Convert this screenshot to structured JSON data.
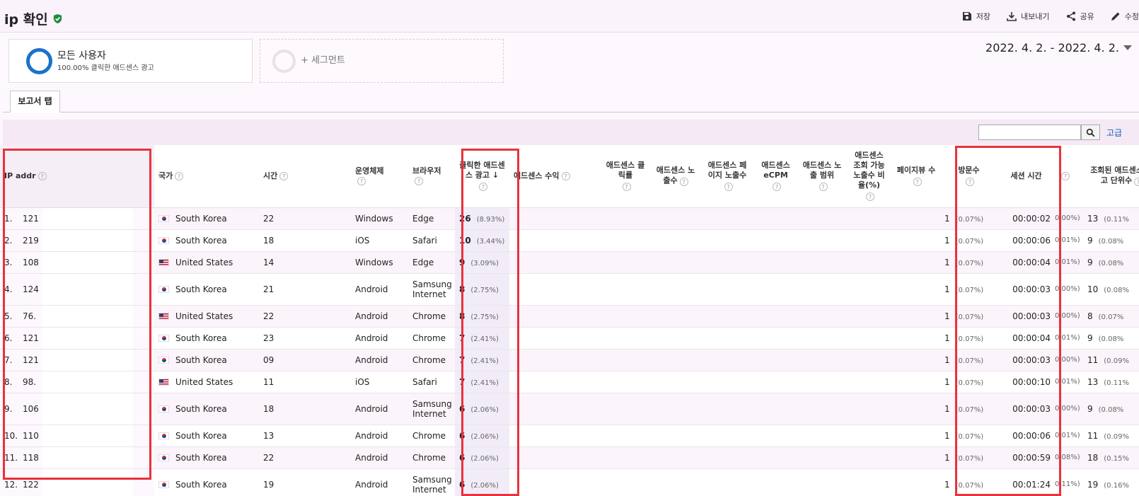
{
  "header": {
    "title": "ip 확인",
    "toolbar": [
      {
        "icon": "save-icon",
        "label": "저장"
      },
      {
        "icon": "download-icon",
        "label": "내보내기"
      },
      {
        "icon": "share-icon",
        "label": "공유"
      },
      {
        "icon": "pencil-icon",
        "label": "수정"
      }
    ]
  },
  "segments": {
    "primary": {
      "title": "모든 사용자",
      "subtitle": "100.00% 클릭한 애드센스 광고"
    },
    "add": {
      "label": "+ 세그먼트"
    }
  },
  "date_range": "2022. 4. 2. - 2022. 4. 2.",
  "tabs": [
    {
      "label": "보고서 탭"
    }
  ],
  "filter": {
    "advanced_label": "고급"
  },
  "table": {
    "headers": {
      "ip": "IP addr",
      "country": "국가",
      "hour": "시간",
      "os": "운영체제",
      "browser": "브라우저",
      "clicks": "클릭한 애드센스 광고",
      "revenue": "애드센스 수익",
      "ctr": "애드센스 클릭률",
      "impressions": "애드센스 노출수",
      "page_impressions": "애드센스 페이지 노출수",
      "ecpm": "애드센스 eCPM",
      "coverage": "애드센스 노출 범위",
      "viewable": "애드센스 조회 가능 노출수 비율(%)",
      "pageviews": "페이지뷰 수",
      "visits": "방문수",
      "session": "세션 시간",
      "ad_units": "조회된 애드센스 광고 단위수"
    },
    "rows": [
      {
        "rank": "1.",
        "ip": "121",
        "flag": "kr",
        "country": "South Korea",
        "hour": "22",
        "os": "Windows",
        "browser": "Edge",
        "clicks": "26",
        "clicks_pct": "(8.93%)",
        "visits": "1",
        "visits_pct": "(0.07%)",
        "session": "00:00:02",
        "session_pct": "0.00%)",
        "units": "13",
        "units_pct": "(0.11%"
      },
      {
        "rank": "2.",
        "ip": "219",
        "flag": "kr",
        "country": "South Korea",
        "hour": "18",
        "os": "iOS",
        "browser": "Safari",
        "clicks": "10",
        "clicks_pct": "(3.44%)",
        "visits": "1",
        "visits_pct": "(0.07%)",
        "session": "00:00:06",
        "session_pct": "0.01%)",
        "units": "9",
        "units_pct": "(0.08%"
      },
      {
        "rank": "3.",
        "ip": "108",
        "flag": "us",
        "country": "United States",
        "hour": "14",
        "os": "Windows",
        "browser": "Edge",
        "clicks": "9",
        "clicks_pct": "(3.09%)",
        "visits": "1",
        "visits_pct": "(0.07%)",
        "session": "00:00:04",
        "session_pct": "0.01%)",
        "units": "9",
        "units_pct": "(0.08%"
      },
      {
        "rank": "4.",
        "ip": "124",
        "flag": "kr",
        "country": "South Korea",
        "hour": "21",
        "os": "Android",
        "browser": "Samsung Internet",
        "clicks": "8",
        "clicks_pct": "(2.75%)",
        "visits": "1",
        "visits_pct": "(0.07%)",
        "session": "00:00:03",
        "session_pct": "0.00%)",
        "units": "10",
        "units_pct": "(0.08%"
      },
      {
        "rank": "5.",
        "ip": "76.",
        "flag": "us",
        "country": "United States",
        "hour": "22",
        "os": "Android",
        "browser": "Chrome",
        "clicks": "8",
        "clicks_pct": "(2.75%)",
        "visits": "1",
        "visits_pct": "(0.07%)",
        "session": "00:00:03",
        "session_pct": "0.00%)",
        "units": "8",
        "units_pct": "(0.07%"
      },
      {
        "rank": "6.",
        "ip": "121",
        "flag": "kr",
        "country": "South Korea",
        "hour": "23",
        "os": "Android",
        "browser": "Chrome",
        "clicks": "7",
        "clicks_pct": "(2.41%)",
        "visits": "1",
        "visits_pct": "(0.07%)",
        "session": "00:00:04",
        "session_pct": "0.01%)",
        "units": "9",
        "units_pct": "(0.08%"
      },
      {
        "rank": "7.",
        "ip": "121",
        "flag": "kr",
        "country": "South Korea",
        "hour": "09",
        "os": "Android",
        "browser": "Chrome",
        "clicks": "7",
        "clicks_pct": "(2.41%)",
        "visits": "1",
        "visits_pct": "(0.07%)",
        "session": "00:00:03",
        "session_pct": "0.00%)",
        "units": "11",
        "units_pct": "(0.09%"
      },
      {
        "rank": "8.",
        "ip": "98.",
        "flag": "us",
        "country": "United States",
        "hour": "11",
        "os": "iOS",
        "browser": "Safari",
        "clicks": "7",
        "clicks_pct": "(2.41%)",
        "visits": "1",
        "visits_pct": "(0.07%)",
        "session": "00:00:10",
        "session_pct": "0.01%)",
        "units": "13",
        "units_pct": "(0.11%"
      },
      {
        "rank": "9.",
        "ip": "106",
        "flag": "kr",
        "country": "South Korea",
        "hour": "18",
        "os": "Android",
        "browser": "Samsung Internet",
        "clicks": "6",
        "clicks_pct": "(2.06%)",
        "visits": "1",
        "visits_pct": "(0.07%)",
        "session": "00:00:03",
        "session_pct": "0.00%)",
        "units": "9",
        "units_pct": "(0.08%"
      },
      {
        "rank": "10.",
        "ip": "110",
        "flag": "kr",
        "country": "South Korea",
        "hour": "13",
        "os": "Android",
        "browser": "Chrome",
        "clicks": "6",
        "clicks_pct": "(2.06%)",
        "visits": "1",
        "visits_pct": "(0.07%)",
        "session": "00:00:06",
        "session_pct": "0.01%)",
        "units": "11",
        "units_pct": "(0.09%"
      },
      {
        "rank": "11.",
        "ip": "118",
        "flag": "kr",
        "country": "South Korea",
        "hour": "22",
        "os": "Android",
        "browser": "Chrome",
        "clicks": "6",
        "clicks_pct": "(2.06%)",
        "visits": "1",
        "visits_pct": "(0.07%)",
        "session": "00:00:59",
        "session_pct": "0.08%)",
        "units": "18",
        "units_pct": "(0.15%"
      },
      {
        "rank": "12.",
        "ip": "122",
        "flag": "kr",
        "country": "South Korea",
        "hour": "19",
        "os": "Android",
        "browser": "Samsung Internet",
        "clicks": "6",
        "clicks_pct": "(2.06%)",
        "visits": "1",
        "visits_pct": "(0.07%)",
        "session": "00:01:24",
        "session_pct": "0.11%)",
        "units": "19",
        "units_pct": "(0.16%"
      }
    ]
  }
}
